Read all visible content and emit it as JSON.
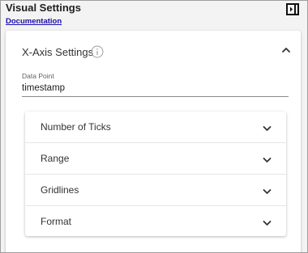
{
  "panel": {
    "title": "Visual Settings",
    "doc_link": "Documentation"
  },
  "icons": {
    "collapse_panel": "panel-collapse-icon",
    "info": "info-icon",
    "expand_less": "chevron-up-icon",
    "expand_more": "chevron-down-icon"
  },
  "xaxis": {
    "title": "X-Axis Settings",
    "data_point": {
      "label": "Data Point",
      "value": "timestamp"
    },
    "sub_sections": [
      {
        "label": "Number of Ticks"
      },
      {
        "label": "Range"
      },
      {
        "label": "Gridlines"
      },
      {
        "label": "Format"
      }
    ]
  }
}
